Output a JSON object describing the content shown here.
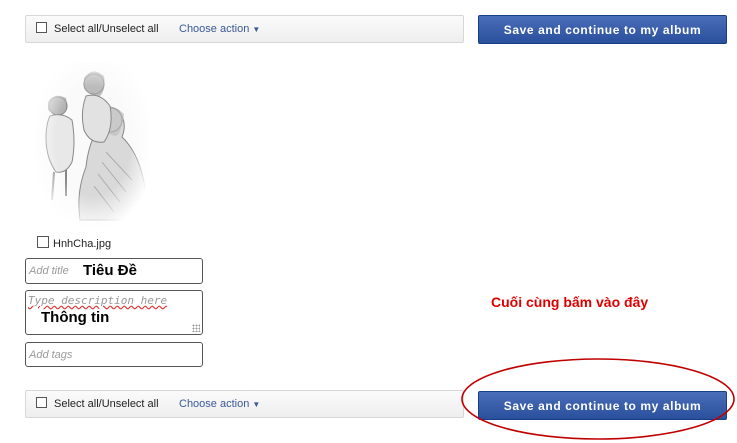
{
  "toolbar": {
    "select_all_label": "Select all/Unselect all",
    "choose_action_label": "Choose action",
    "save_label": "Save and continue to my album"
  },
  "photo": {
    "filename": "HnhCha.jpg",
    "title_placeholder": "Add title",
    "title_value": "Tiêu Đề",
    "description_placeholder": "Type description here",
    "description_value": "Thông tin",
    "tags_placeholder": "Add tags"
  },
  "annotation": {
    "text": "Cuối cùng bấm vào đây",
    "color": "#e00000"
  },
  "colors": {
    "button_blue": "#2a4f9c",
    "link_blue": "#3b5998"
  }
}
